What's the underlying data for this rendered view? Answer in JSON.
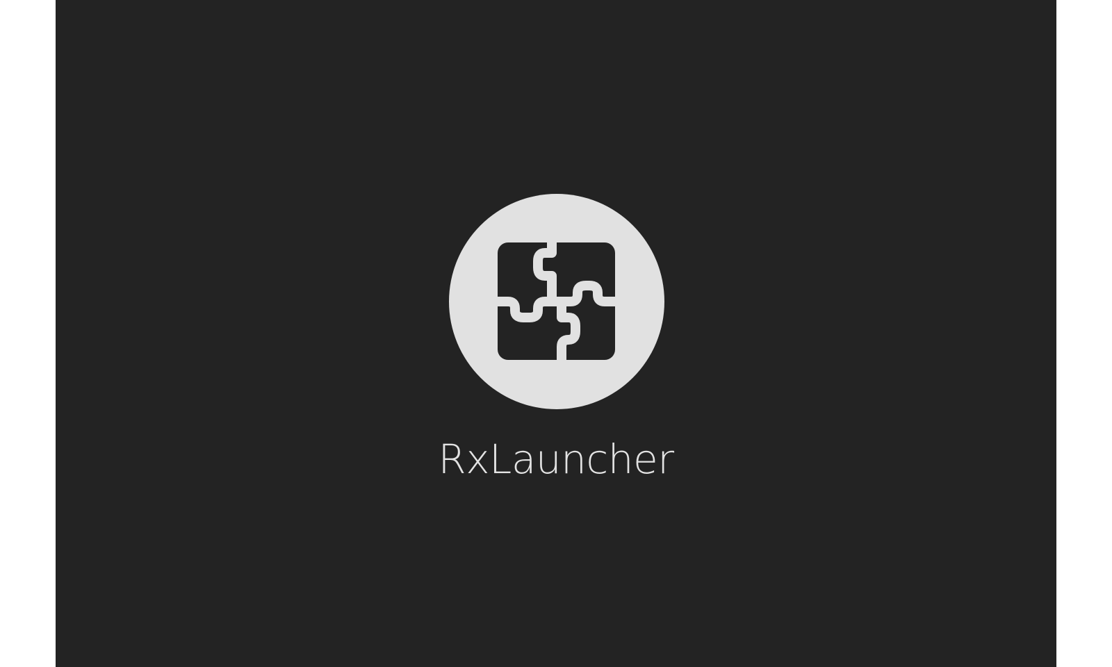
{
  "splash": {
    "app_name": "RxLauncher",
    "logo_icon": "puzzle-pieces-icon"
  },
  "colors": {
    "window_background": "#232323",
    "page_background": "#ffffff",
    "logo_circle": "#e1e1e1",
    "logo_glyph": "#232323",
    "text": "#e3e3e3"
  }
}
